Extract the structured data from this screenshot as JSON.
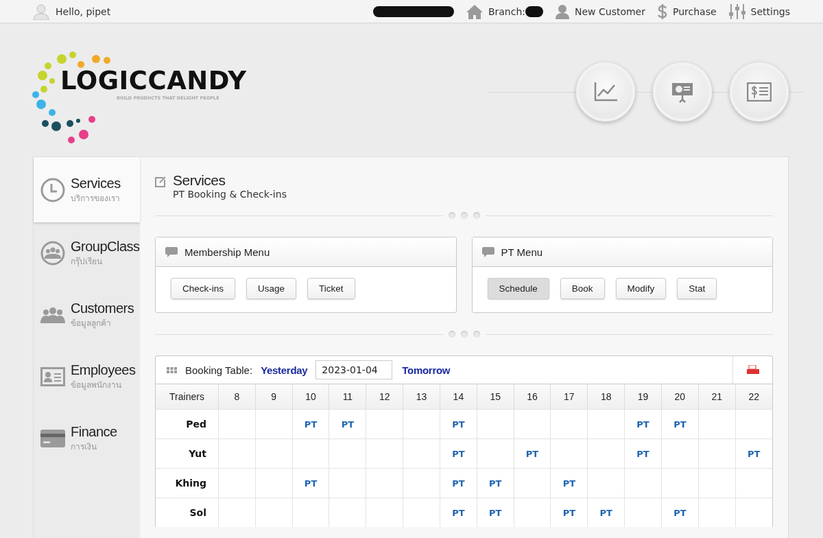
{
  "top_bar": {
    "greeting": "Hello, pipet",
    "branch_label": "Branch:",
    "links": [
      {
        "kind": "customer",
        "label": "New Customer"
      },
      {
        "kind": "purchase",
        "label": "Purchase"
      },
      {
        "kind": "settings",
        "label": "Settings"
      }
    ]
  },
  "logo": {
    "name": "LOGICCANDY",
    "tagline": "BUILD PRODUCTS THAT DELIGHT PEOPLE"
  },
  "header_buttons": [
    {
      "kind": "chart"
    },
    {
      "kind": "presentation"
    },
    {
      "kind": "invoice"
    }
  ],
  "sidebar": {
    "items": [
      {
        "kind": "clock",
        "title": "Services",
        "subtitle": "บริการของเรา",
        "selected": true
      },
      {
        "kind": "group",
        "title": "GroupClass",
        "subtitle": "กรุ๊ปเรียน",
        "selected": false
      },
      {
        "kind": "people",
        "title": "Customers",
        "subtitle": "ข้อมูลลูกค้า",
        "selected": false
      },
      {
        "kind": "card",
        "title": "Employees",
        "subtitle": "ข้อมูลพนักงาน",
        "selected": false
      },
      {
        "kind": "credit",
        "title": "Finance",
        "subtitle": "การเงิน",
        "selected": false
      }
    ]
  },
  "page": {
    "title": "Services",
    "subtitle": "PT Booking & Check-ins"
  },
  "menus": [
    {
      "title": "Membership Menu",
      "buttons": [
        {
          "label": "Check-ins",
          "selected": false
        },
        {
          "label": "Usage",
          "selected": false
        },
        {
          "label": "Ticket",
          "selected": false
        }
      ]
    },
    {
      "title": "PT Menu",
      "buttons": [
        {
          "label": "Schedule",
          "selected": true
        },
        {
          "label": "Book",
          "selected": false
        },
        {
          "label": "Modify",
          "selected": false
        },
        {
          "label": "Stat",
          "selected": false
        }
      ]
    }
  ],
  "booking_table": {
    "title": "Booking Table:",
    "prev": "Yesterday",
    "date": "2023-01-04",
    "next": "Tomorrow",
    "columns": [
      "Trainers",
      "8",
      "9",
      "10",
      "11",
      "12",
      "13",
      "14",
      "15",
      "16",
      "17",
      "18",
      "19",
      "20",
      "21",
      "22"
    ],
    "rows": [
      {
        "cells": [
          "Ped",
          "",
          "",
          "PT",
          "PT",
          "",
          "",
          "PT",
          "",
          "",
          "",
          "",
          "PT",
          "PT",
          "",
          ""
        ]
      },
      {
        "cells": [
          "Yut",
          "",
          "",
          "",
          "",
          "",
          "",
          "PT",
          "",
          "PT",
          "",
          "",
          "PT",
          "",
          "",
          "PT"
        ]
      },
      {
        "cells": [
          "Khing",
          "",
          "",
          "PT",
          "",
          "",
          "",
          "PT",
          "PT",
          "",
          "PT",
          "",
          "",
          "",
          "",
          ""
        ]
      },
      {
        "cells": [
          "Sol",
          "",
          "",
          "",
          "",
          "",
          "",
          "PT",
          "PT",
          "",
          "PT",
          "PT",
          "",
          "PT",
          "",
          ""
        ]
      }
    ]
  }
}
